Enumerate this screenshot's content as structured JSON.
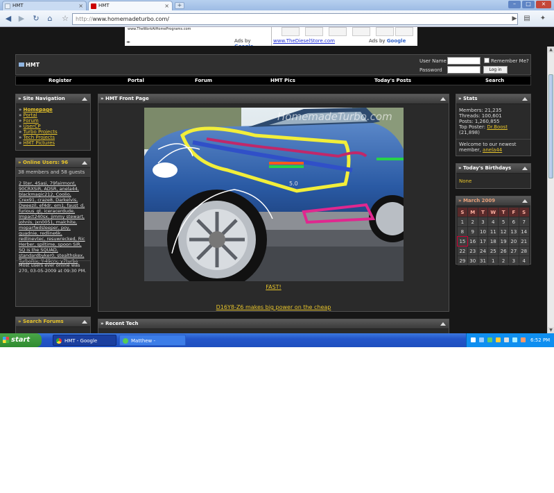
{
  "browser": {
    "tabs": [
      {
        "label": "HMT"
      },
      {
        "label": "HMT"
      }
    ],
    "new_tab": "+",
    "url_scheme": "http://",
    "url_host": "www.homemadeturbo.com/"
  },
  "ads": {
    "ad1_url": "www.TheWorkAtHomePrograms.com",
    "ad1_adsby": "Ads by",
    "ad2_url": "www.TheDieselStore.com",
    "ad2_adsby": "Ads by",
    "google": "Google"
  },
  "header": {
    "logo_text": "HMT",
    "username_label": "User Name",
    "password_label": "Password",
    "remember_label": "Remember Me?",
    "login_button": "Log in"
  },
  "nav": {
    "items": [
      "Register",
      "Portal",
      "Forum",
      "HMT Pics",
      "Today's Posts",
      "Search"
    ]
  },
  "site_navigation": {
    "title": "Site Navigation",
    "items": [
      "Homepage",
      "Portal",
      "Forum",
      "UserCP",
      "Turbo Projects",
      "Tech Projects",
      "HMT Pictures"
    ]
  },
  "online": {
    "title": "Online Users: 96",
    "summary": "38 members and 58 guests",
    "users_text": "2 liter, 4Sasi, 79fairmont, 90CRXSiR, ADSR, anela44, blackmagic212, Coolio, Crex91, craze8, Darkelvis, Dweezil, ef4dr, em1, faust_d, furious_gt, iceracerdude, Impact240sx, jimmy stewart, johnls, jxn0051, malchite, moparfwdsleeper, poy, quadnie, redline6k, redlinevtec, resuwrecked, Ric Herber, spiltime, spoon SiR, SQ is the SQUAD, standardbyker0, stealthskex, TurboRix, Y-49crx, y7turbo",
    "record_text": "Most users ever online was 270, 03-05-2009 at 09:30 PM."
  },
  "search_forums": {
    "title": "Search Forums"
  },
  "front_page": {
    "title": "HMT Front Page",
    "watermark": "HomemadeTurbo.com",
    "badge": "5.0",
    "caption1": "FAST!",
    "caption2": "D16Y8-Z6 makes big power on the cheap"
  },
  "recent_tech": {
    "title": "Recent Tech"
  },
  "stats": {
    "title": "Stats",
    "members": "Members: 21,235",
    "threads": "Threads: 100,601",
    "posts": "Posts: 1,260,855",
    "top_poster_prefix": "Top Poster:",
    "top_poster_name": "Dr.Boost",
    "top_poster_count": "(21,898)",
    "welcome_prefix": "Welcome to our newest member,",
    "welcome_name": "anela44"
  },
  "birthdays": {
    "title": "Today's Birthdays",
    "text": "None"
  },
  "calendar": {
    "title": "March 2009",
    "weekdays": [
      "S",
      "M",
      "T",
      "W",
      "T",
      "F",
      "S"
    ],
    "weeks": [
      [
        "1",
        "2",
        "3",
        "4",
        "5",
        "6",
        "7"
      ],
      [
        "8",
        "9",
        "10",
        "11",
        "12",
        "13",
        "14"
      ],
      [
        "15",
        "16",
        "17",
        "18",
        "19",
        "20",
        "21"
      ],
      [
        "22",
        "23",
        "24",
        "25",
        "26",
        "27",
        "28"
      ],
      [
        "29",
        "30",
        "31",
        "1",
        "2",
        "3",
        "4"
      ]
    ],
    "today": "15"
  },
  "taskbar": {
    "start": "start",
    "tasks": [
      "HMT - Google Chrome",
      "Matthew - Conversation"
    ],
    "clock": "6:52 PM"
  },
  "colors": {
    "accent_yellow": "#e8c52b",
    "page_background": "#171717",
    "taskbar_blue": "#2456c9"
  }
}
